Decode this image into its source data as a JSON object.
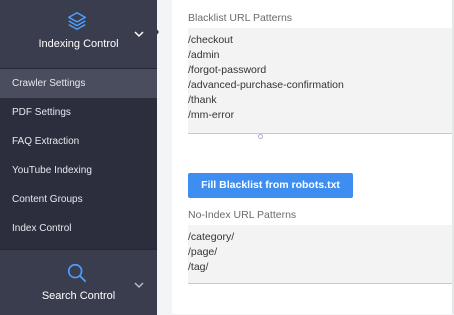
{
  "sidebar": {
    "top_section": {
      "label": "Indexing Control",
      "icon": "layers-icon"
    },
    "items": [
      {
        "label": "Crawler Settings",
        "selected": true
      },
      {
        "label": "PDF Settings",
        "selected": false
      },
      {
        "label": "FAQ Extraction",
        "selected": false
      },
      {
        "label": "YouTube Indexing",
        "selected": false
      },
      {
        "label": "Content Groups",
        "selected": false
      },
      {
        "label": "Index Control",
        "selected": false
      }
    ],
    "bottom_section": {
      "label": "Search Control",
      "icon": "search-icon"
    }
  },
  "main": {
    "blacklist": {
      "label": "Blacklist URL Patterns",
      "lines": [
        "/checkout",
        "/admin",
        "/forgot-password",
        "/advanced-purchase-confirmation",
        "/thank",
        "/mm-error"
      ]
    },
    "fill_button_label": "Fill Blacklist from robots.txt",
    "noindex": {
      "label": "No-Index URL Patterns",
      "lines": [
        "/category/",
        "/page/",
        "/tag/"
      ]
    }
  },
  "colors": {
    "sidebar_bg": "#2c2e3e",
    "section_bg": "#3a3d4e",
    "selected_item_bg": "#4a4d5e",
    "accent": "#3e8df0"
  }
}
